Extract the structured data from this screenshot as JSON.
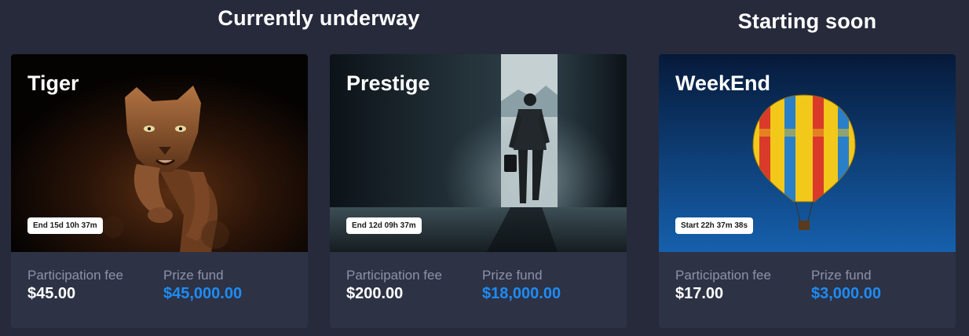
{
  "sections": {
    "underway_title": "Currently underway",
    "soon_title": "Starting soon"
  },
  "cards": [
    {
      "title": "Tiger",
      "timer": "End 15d 10h 37m",
      "fee_label": "Participation fee",
      "fee_value": "$45.00",
      "prize_label": "Prize fund",
      "prize_value": "$45,000.00",
      "image": "puma-running"
    },
    {
      "title": "Prestige",
      "timer": "End 12d 09h 37m",
      "fee_label": "Participation fee",
      "fee_value": "$200.00",
      "prize_label": "Prize fund",
      "prize_value": "$18,000.00",
      "image": "businessman-walking-to-door"
    },
    {
      "title": "WeekEnd",
      "timer": "Start 22h 37m 38s",
      "fee_label": "Participation fee",
      "fee_value": "$17.00",
      "prize_label": "Prize fund",
      "prize_value": "$3,000.00",
      "image": "hot-air-balloon"
    }
  ],
  "colors": {
    "background": "#262a3b",
    "card": "#2d3245",
    "prize_accent": "#1e8cf5",
    "label": "#8d92a6"
  }
}
